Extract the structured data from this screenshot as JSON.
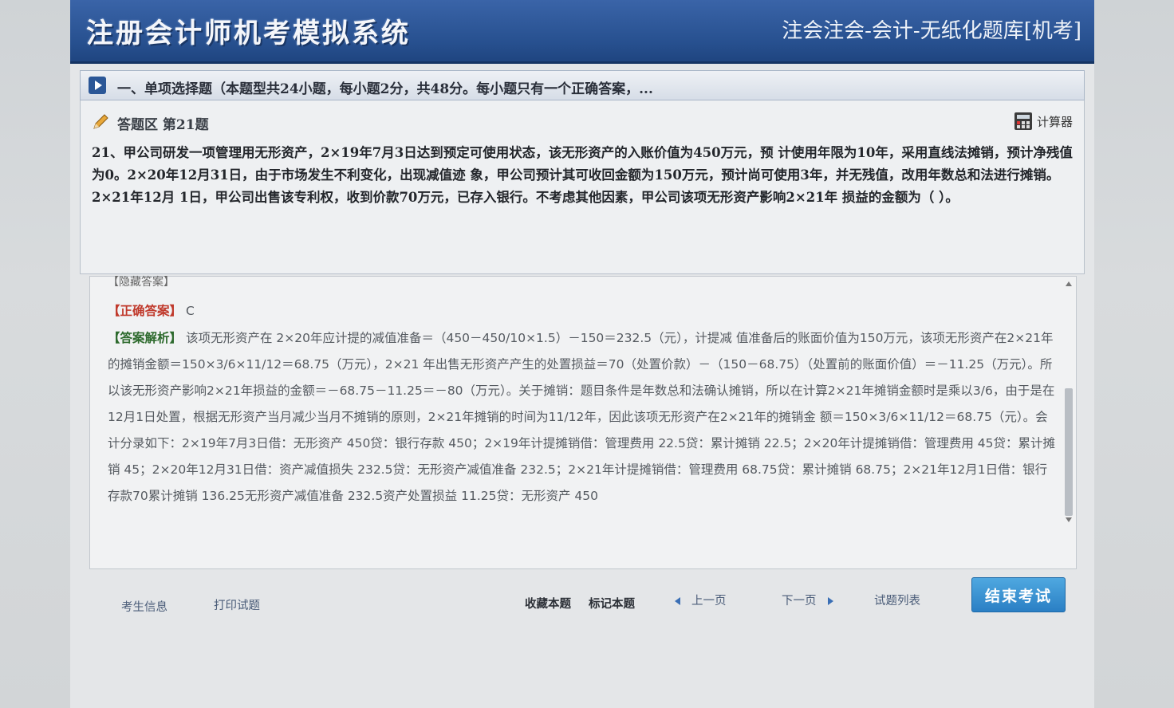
{
  "header": {
    "brand": "注册会计师机考模拟系统",
    "subtitle": "注会注会-会计-无纸化题库[机考]"
  },
  "section": {
    "text": "一、单项选择题（本题型共24小题，每小题2分，共48分。每小题只有一个正确答案，..."
  },
  "question": {
    "area_title": "答题区 第21题",
    "calculator_label": "计算器",
    "text": "21、甲公司研发一项管理用无形资产，2×19年7月3日达到预定可使用状态，该无形资产的入账价值为450万元，预 计使用年限为10年，采用直线法摊销，预计净残值为0。2×20年12月31日，由于市场发生不利变化，出现减值迹 象，甲公司预计其可收回金额为150万元，预计尚可使用3年，并无残值，改用年数总和法进行摊销。2×21年12月 1日，甲公司出售该专利权，收到价款70万元，已存入银行。不考虑其他因素，甲公司该项无形资产影响2×21年 损益的金额为（ ）。"
  },
  "answer": {
    "hide_label": "【隐藏答案】",
    "correct_label": "【正确答案】",
    "correct_value": "C",
    "analysis_label": "【答案解析】",
    "analysis_text": "该项无形资产在 2×20年应计提的减值准备＝（450－450/10×1.5）－150＝232.5（元），计提减 值准备后的账面价值为150万元，该项无形资产在2×21年的摊销金额＝150×3/6×11/12＝68.75（万元），2×21 年出售无形资产产生的处置损益＝70（处置价款）－（150－68.75）（处置前的账面价值）＝－11.25（万元）。所以该无形资产影响2×21年损益的金额＝－68.75－11.25＝－80（万元）。关于摊销：题目条件是年数总和法确认摊销，所以在计算2×21年摊销金额时是乘以3/6，由于是在12月1日处置，根据无形资产当月减少当月不摊销的原则，2×21年摊销的时间为11/12年，因此该项无形资产在2×21年的摊销金 额＝150×3/6×11/12＝68.75（元）。会计分录如下：2×19年7月3日借：无形资产 450贷：银行存款 450；2×19年计提摊销借：管理费用 22.5贷：累计摊销 22.5；2×20年计提摊销借：管理费用 45贷：累计摊销 45；2×20年12月31日借：资产减值损失 232.5贷：无形资产减值准备 232.5；2×21年计提摊销借：管理费用 68.75贷：累计摊销 68.75；2×21年12月1日借：银行存款70累计摊销 136.25无形资产减值准备 232.5资产处置损益 11.25贷：无形资产 450"
  },
  "toolbar": {
    "candidate_info": "考生信息",
    "print": "打印试题",
    "favorite": "收藏本题",
    "mark": "标记本题",
    "prev": "上一页",
    "next": "下一页",
    "question_list": "试题列表",
    "end_exam": "结束考试"
  }
}
